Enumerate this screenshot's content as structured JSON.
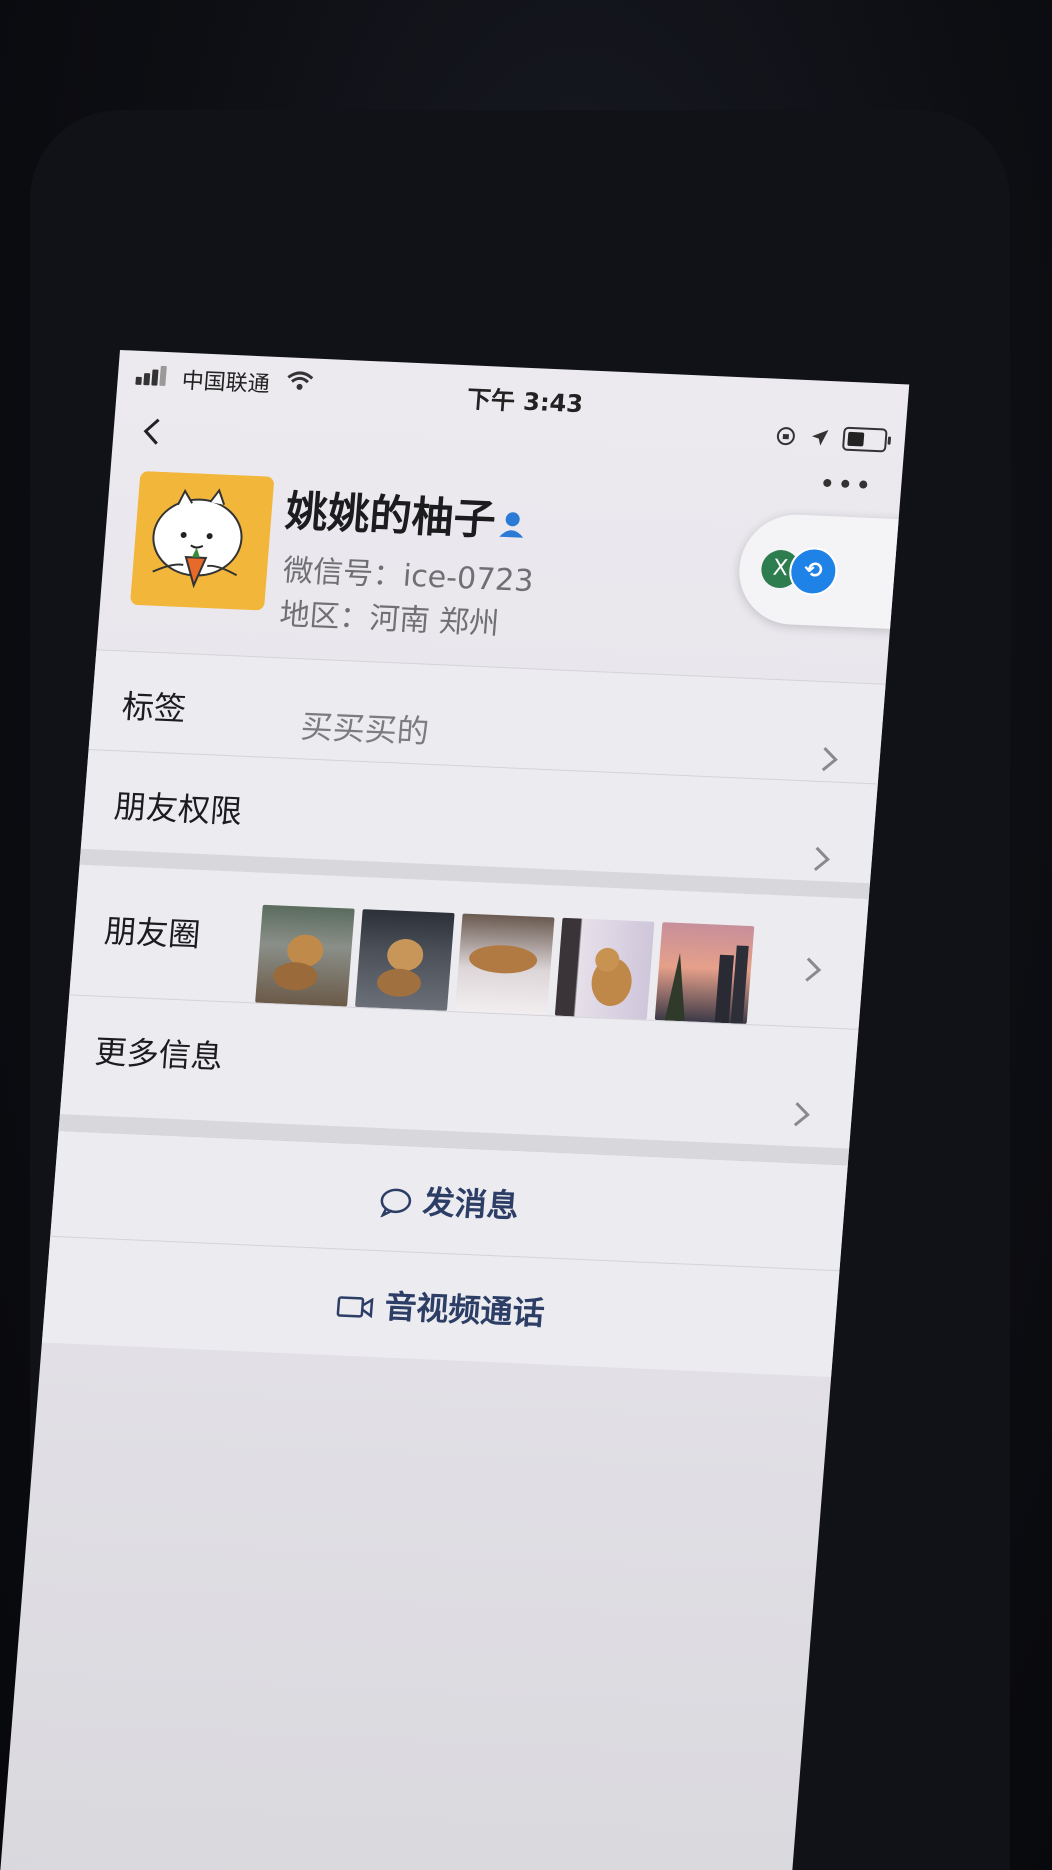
{
  "status_bar": {
    "carrier": "中国联通",
    "time": "下午 3:43"
  },
  "profile": {
    "name": "姚姚的柚子",
    "wechat_id": "微信号：ice-0723",
    "region": "地区：河南 郑州"
  },
  "floating": {
    "left_badge": "X"
  },
  "rows": {
    "tags_label": "标签",
    "tags_value": "买买买的",
    "permissions_label": "朋友权限",
    "moments_label": "朋友圈",
    "more_info_label": "更多信息"
  },
  "actions": {
    "send_message": "发消息",
    "av_call": "音视频通话"
  },
  "colors": {
    "accent_link": "#2c3e66",
    "avatar_bg": "#f2b63b",
    "verified_icon": "#2b7ad6"
  },
  "icons": [
    "back-icon",
    "more-icon",
    "person-icon",
    "chevron-right-icon",
    "chat-bubble-icon",
    "video-camera-icon",
    "wifi-icon",
    "signal-icon",
    "battery-icon",
    "location-icon",
    "lock-rotation-icon"
  ]
}
